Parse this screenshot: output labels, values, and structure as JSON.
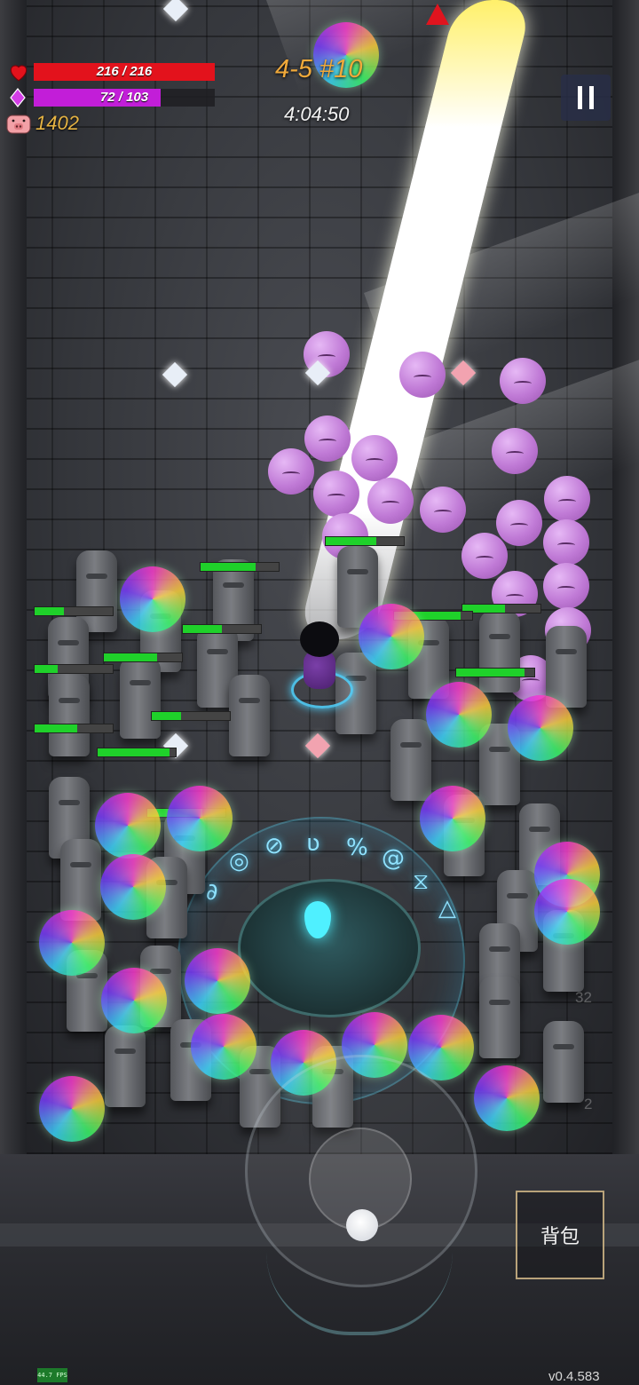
{
  "hud": {
    "hp": {
      "current": 216,
      "max": 216,
      "text": "216 / 216",
      "color": "#e3121c"
    },
    "mana": {
      "current": 72,
      "max": 103,
      "text": "72 / 103",
      "color": "#c21ed8"
    },
    "coins": "1402",
    "stage": "4-5 #10",
    "timer": "4:04:50"
  },
  "icons": {
    "hp": "heart-icon",
    "mana": "gem-icon",
    "coins": "pig-icon",
    "pause": "pause-icon",
    "objective": "red-arrow-icon"
  },
  "controls": {
    "bag_label": "背包",
    "joystick": "virtual-joystick"
  },
  "side_counts": {
    "top": "32",
    "bottom": "2"
  },
  "debug": {
    "fps": "44.7 FPS",
    "version": "v0.4.583"
  },
  "colors": {
    "enemy_hp": "#1fd12a",
    "stage_text": "#f0a93a",
    "coins_text": "#e6b443",
    "rune": "#8fe2ff"
  }
}
